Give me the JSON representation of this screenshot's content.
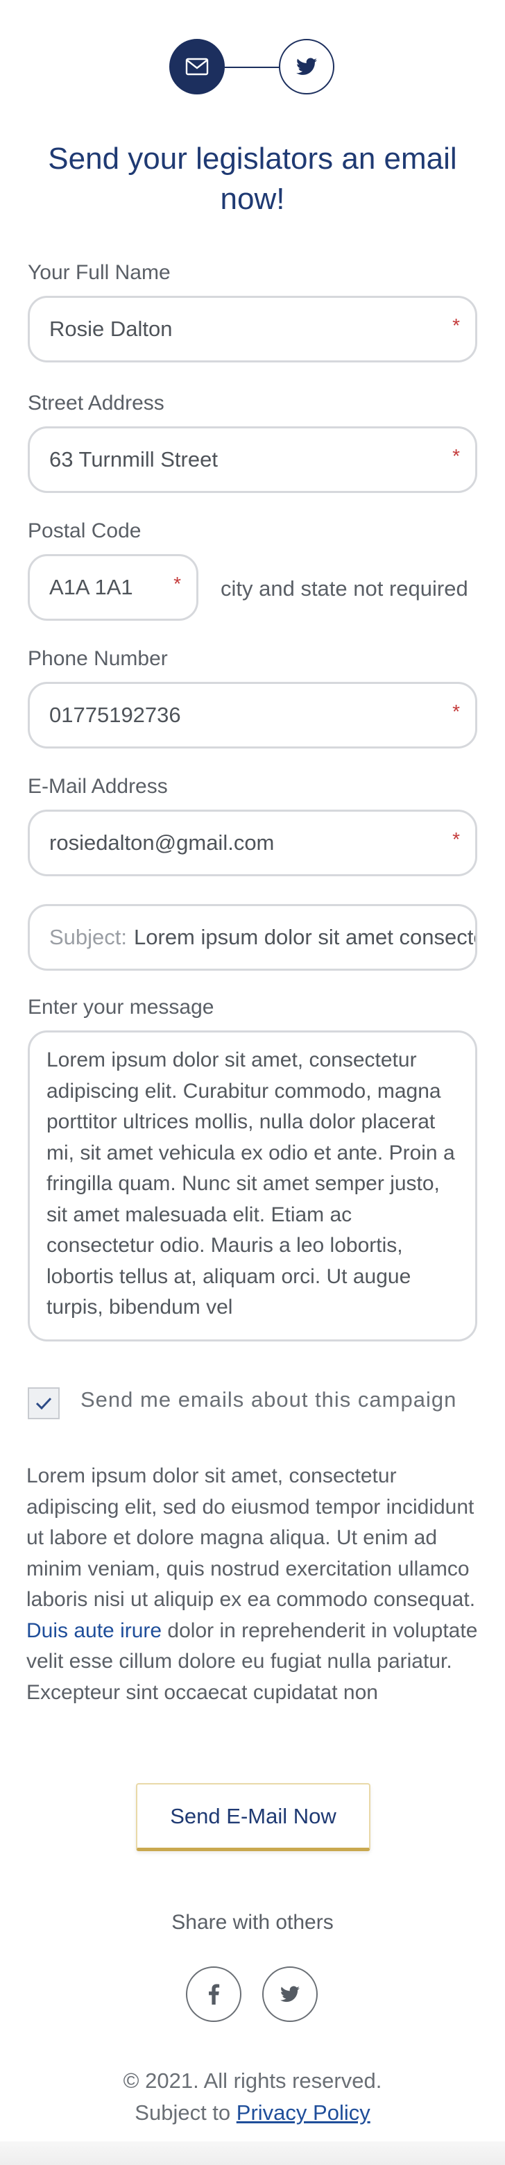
{
  "steps": [
    {
      "icon": "envelope-icon",
      "active": true
    },
    {
      "icon": "twitter-icon",
      "active": false
    }
  ],
  "headline": "Send your legislators an email now!",
  "form": {
    "full_name": {
      "label": "Your Full Name",
      "value": "Rosie Dalton",
      "required_mark": "*"
    },
    "street": {
      "label": "Street Address",
      "value": "63 Turnmill Street",
      "required_mark": "*"
    },
    "postal": {
      "label": "Postal Code",
      "value": "A1A 1A1",
      "required_mark": "*",
      "note": "city and state not required"
    },
    "phone": {
      "label": "Phone Number",
      "value": "01775192736",
      "required_mark": "*"
    },
    "email": {
      "label": "E-Mail Address",
      "value": "rosiedalton@gmail.com",
      "required_mark": "*"
    },
    "subject": {
      "prefix": "Subject:",
      "value": "Lorem ipsum dolor sit amet consectetur"
    },
    "message": {
      "label": "Enter your message",
      "value": "Lorem ipsum dolor sit amet, consectetur adipiscing elit. Curabitur commodo, magna porttitor ultrices mollis, nulla dolor placerat mi, sit amet vehicula ex odio et ante. Proin a fringilla quam. Nunc sit amet semper justo, sit amet malesuada elit. Etiam ac consectetur odio. Mauris a leo lobortis, lobortis tellus at, aliquam orci. Ut augue turpis, bibendum vel"
    },
    "opt_in": {
      "label": "Send me emails about this campaign",
      "checked": true
    }
  },
  "legal": {
    "text_before": "Lorem ipsum dolor sit amet, consectetur adipiscing elit, sed do eiusmod tempor incididunt ut labore et dolore magna aliqua. Ut enim ad minim veniam, quis nostrud exercitation ullamco laboris nisi ut aliquip ex ea commodo consequat. ",
    "link_text": "Duis aute irure",
    "text_after": " dolor in reprehenderit in voluptate velit esse cillum dolore eu fugiat nulla pariatur. Excepteur sint occaecat cupidatat non"
  },
  "send_button": "Send E-Mail Now",
  "share": {
    "title": "Share with others",
    "icons": [
      "facebook-icon",
      "twitter-icon"
    ]
  },
  "footer": {
    "copyright": "© 2021. All rights reserved.",
    "privacy_prefix": "Subject to",
    "privacy_link": "Privacy Policy"
  },
  "colors": {
    "primary": "#1c2f5e",
    "link": "#1f4e9a",
    "required": "#c43b3b",
    "button_accent": "#c9a84f"
  }
}
